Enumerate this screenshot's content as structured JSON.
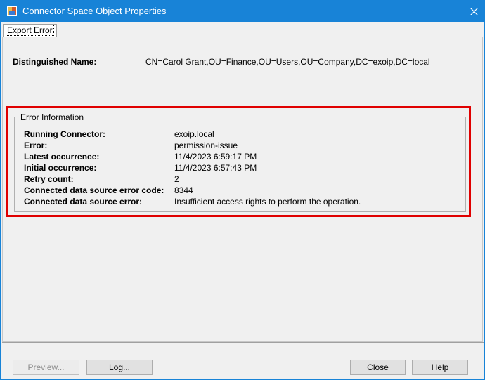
{
  "window": {
    "title": "Connector Space Object Properties",
    "close_glyph": "✕"
  },
  "tabs": [
    {
      "label": "Export Error",
      "active": true
    }
  ],
  "dn": {
    "label": "Distinguished Name:",
    "value": "CN=Carol Grant,OU=Finance,OU=Users,OU=Company,DC=exoip,DC=local"
  },
  "error_info": {
    "legend": "Error Information",
    "rows": [
      {
        "label": "Running Connector:",
        "value": "exoip.local"
      },
      {
        "label": "Error:",
        "value": "permission-issue"
      },
      {
        "label": "Latest occurrence:",
        "value": "11/4/2023 6:59:17 PM"
      },
      {
        "label": "Initial occurrence:",
        "value": "11/4/2023 6:57:43 PM"
      },
      {
        "label": "Retry count:",
        "value": "2"
      },
      {
        "label": "Connected data source error code:",
        "value": "8344"
      },
      {
        "label": "Connected data source error:",
        "value": "Insufficient access rights to perform the operation."
      }
    ]
  },
  "buttons": {
    "preview": "Preview...",
    "log": "Log...",
    "close": "Close",
    "help": "Help"
  },
  "colors": {
    "titlebar": "#1883d7",
    "highlight": "#e00000"
  }
}
